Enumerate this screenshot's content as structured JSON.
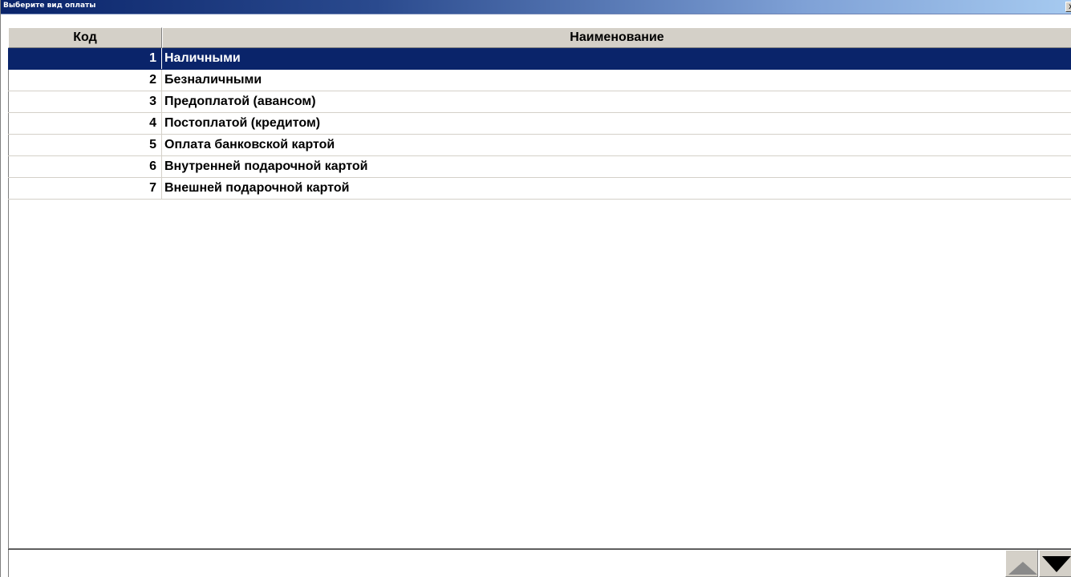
{
  "window": {
    "title": "Выберите вид оплаты",
    "close_glyph": "x"
  },
  "table": {
    "columns": {
      "code": "Код",
      "name": "Наименование"
    },
    "selected_index": 0,
    "rows": [
      {
        "code": "1",
        "name": "Наличными"
      },
      {
        "code": "2",
        "name": "Безналичными"
      },
      {
        "code": "3",
        "name": "Предоплатой (авансом)"
      },
      {
        "code": "4",
        "name": "Постоплатой (кредитом)"
      },
      {
        "code": "5",
        "name": "Оплата банковской картой"
      },
      {
        "code": "6",
        "name": "Внутренней подарочной картой"
      },
      {
        "code": "7",
        "name": "Внешней подарочной картой"
      }
    ]
  },
  "footer": {
    "status_text": "",
    "scroll_up_icon": "triangle-up-icon",
    "scroll_down_icon": "triangle-down-icon"
  },
  "colors": {
    "selection": "#0a246a",
    "titlebar_start": "#0a246a",
    "titlebar_end": "#a6caf0",
    "header_bg": "#d4d0c8"
  }
}
